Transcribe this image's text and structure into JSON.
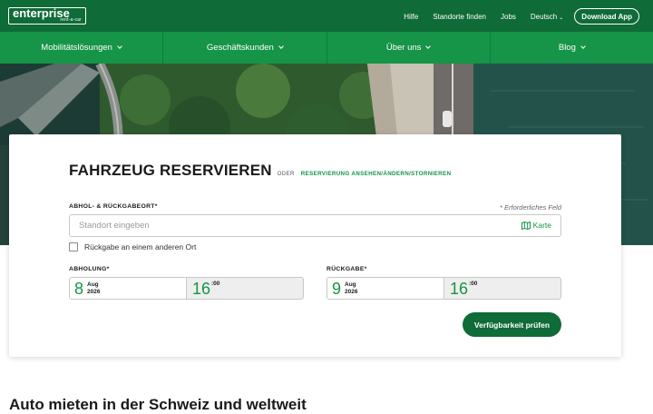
{
  "logo": {
    "name": "enterprise",
    "sub": "rent-a-car"
  },
  "top_links": [
    "Hilfe",
    "Standorte finden",
    "Jobs"
  ],
  "language": "Deutsch",
  "download_app": "Download App",
  "nav": [
    "Mobilitätslösungen",
    "Geschäftskunden",
    "Über uns",
    "Blog"
  ],
  "reservation": {
    "title": "FAHRZEUG RESERVIEREN",
    "oder": "ODER",
    "manage_link": "RESERVIERUNG ANSEHEN/ÄNDERN/STORNIEREN",
    "location_label": "ABHOL- & RÜCKGABEORT*",
    "required_note": "* Erforderliches Feld",
    "location_placeholder": "Standort eingeben",
    "map_label": "Karte",
    "different_return_label": "Rückgabe an einem anderen Ort",
    "pickup": {
      "label": "ABHOLUNG*",
      "day": "8",
      "month": "Aug",
      "year": "2026",
      "hour": "16",
      "minutes": ":00"
    },
    "return": {
      "label": "RÜCKGABE*",
      "day": "9",
      "month": "Aug",
      "year": "2026",
      "hour": "16",
      "minutes": ":00"
    },
    "submit": "Verfügbarkeit prüfen"
  },
  "section_heading": "Auto mieten in der Schweiz und weltweit",
  "colors": {
    "brand_dark": "#0f6b37",
    "brand": "#169447"
  }
}
